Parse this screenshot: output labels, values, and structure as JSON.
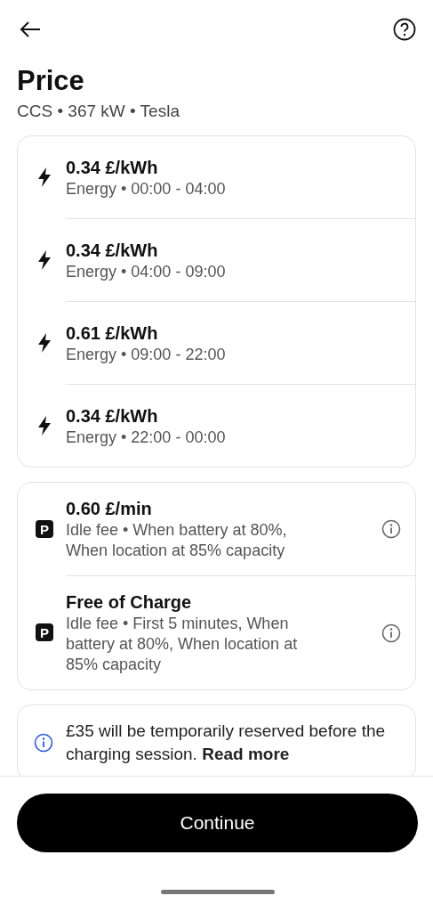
{
  "header": {
    "title": "Price",
    "subtitle": "CCS • 367 kW • Tesla"
  },
  "price_groups": [
    {
      "items": [
        {
          "kind": "energy",
          "price": "0.34 £/kWh",
          "details": "Energy • 00:00 - 04:00"
        },
        {
          "kind": "energy",
          "price": "0.34 £/kWh",
          "details": "Energy • 04:00 - 09:00"
        },
        {
          "kind": "energy",
          "price": "0.61 £/kWh",
          "details": "Energy • 09:00 - 22:00"
        },
        {
          "kind": "energy",
          "price": "0.34 £/kWh",
          "details": "Energy • 22:00 - 00:00"
        }
      ]
    },
    {
      "items": [
        {
          "kind": "parking",
          "badge": "P",
          "price": "0.60 £/min",
          "details": "Idle fee • When battery at 80%, When location at 85% capacity"
        },
        {
          "kind": "parking",
          "badge": "P",
          "price": "Free of Charge",
          "details": "Idle fee • First 5 minutes, When battery at 80%, When location at 85% capacity"
        }
      ]
    }
  ],
  "notice": {
    "text": "£35 will be temporarily reserved before the charging session. **Read more**"
  },
  "button": {
    "label": "Continue"
  }
}
